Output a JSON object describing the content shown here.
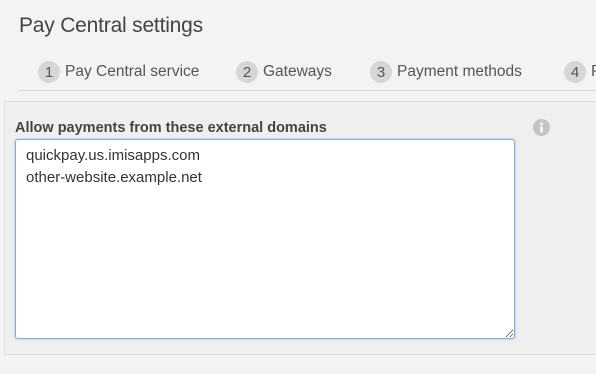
{
  "page": {
    "title": "Pay Central settings"
  },
  "tabs": [
    {
      "number": "1",
      "label": "Pay Central service"
    },
    {
      "number": "2",
      "label": "Gateways"
    },
    {
      "number": "3",
      "label": "Payment methods"
    },
    {
      "number": "4",
      "label": "P"
    }
  ],
  "form": {
    "domains_label": "Allow payments from these external domains",
    "domains_value": "quickpay.us.imisapps.com\nother-website.example.net",
    "info_icon": "info-icon"
  },
  "colors": {
    "focus_border": "#7fb0e0",
    "tab_badge": "#d6d6d6",
    "panel_bg": "#efefef"
  }
}
